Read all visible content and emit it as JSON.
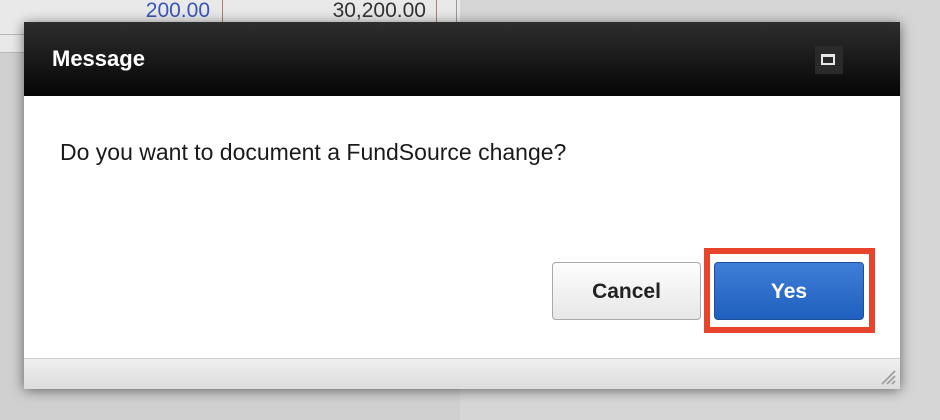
{
  "background": {
    "row_values": [
      "200.00",
      "30,200.00"
    ]
  },
  "dialog": {
    "title": "Message",
    "maximize_icon": "maximize-icon",
    "message": "Do you want to document a FundSource change?",
    "buttons": {
      "cancel_label": "Cancel",
      "yes_label": "Yes"
    },
    "highlight_color": "#e8432b",
    "primary_color": "#2d6fcb"
  }
}
